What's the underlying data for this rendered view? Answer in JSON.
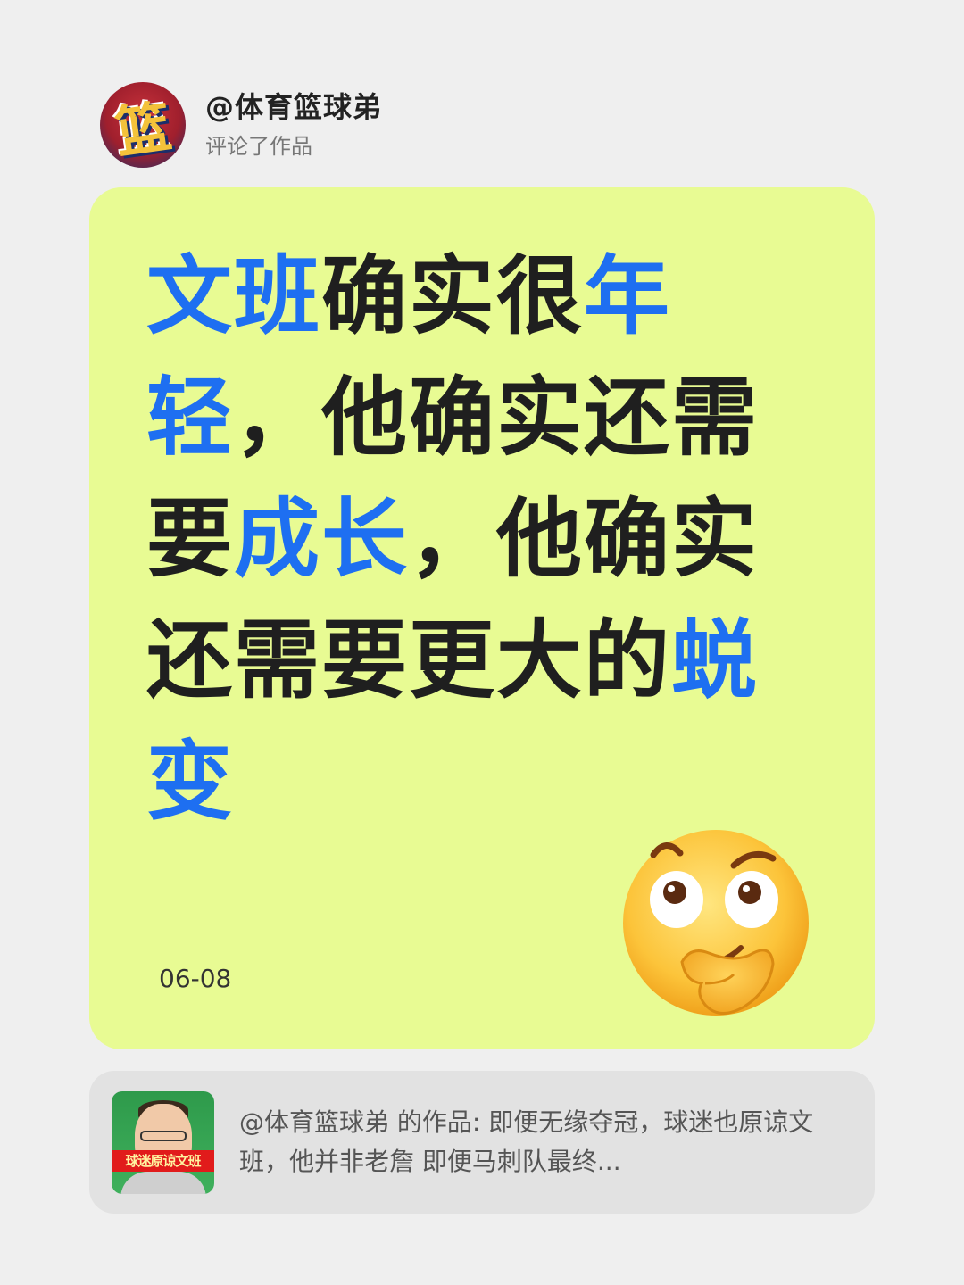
{
  "header": {
    "username": "@体育篮球弟",
    "action": "评论了作品",
    "avatar_text": "篮"
  },
  "comment": {
    "segments": [
      {
        "text": "文班",
        "highlight": true
      },
      {
        "text": "确实很",
        "highlight": false
      },
      {
        "text": "年轻",
        "highlight": true
      },
      {
        "text": "，他确实还需要",
        "highlight": false
      },
      {
        "text": "成长",
        "highlight": true
      },
      {
        "text": "，他确实还需要更大的",
        "highlight": false
      },
      {
        "text": "蜕变",
        "highlight": true
      }
    ],
    "date": "06-08",
    "emoji": "thinking-face"
  },
  "work": {
    "thumbnail_caption": "球迷原谅文班",
    "description": "@体育篮球弟 的作品: 即便无缘夺冠，球迷也原谅文班，他并非老詹 即便马刺队最终..."
  },
  "colors": {
    "background": "#efefef",
    "card": "#e8fb93",
    "highlight": "#1e6ff1",
    "text": "#1f1f1f",
    "work_card": "#e2e2e2"
  }
}
